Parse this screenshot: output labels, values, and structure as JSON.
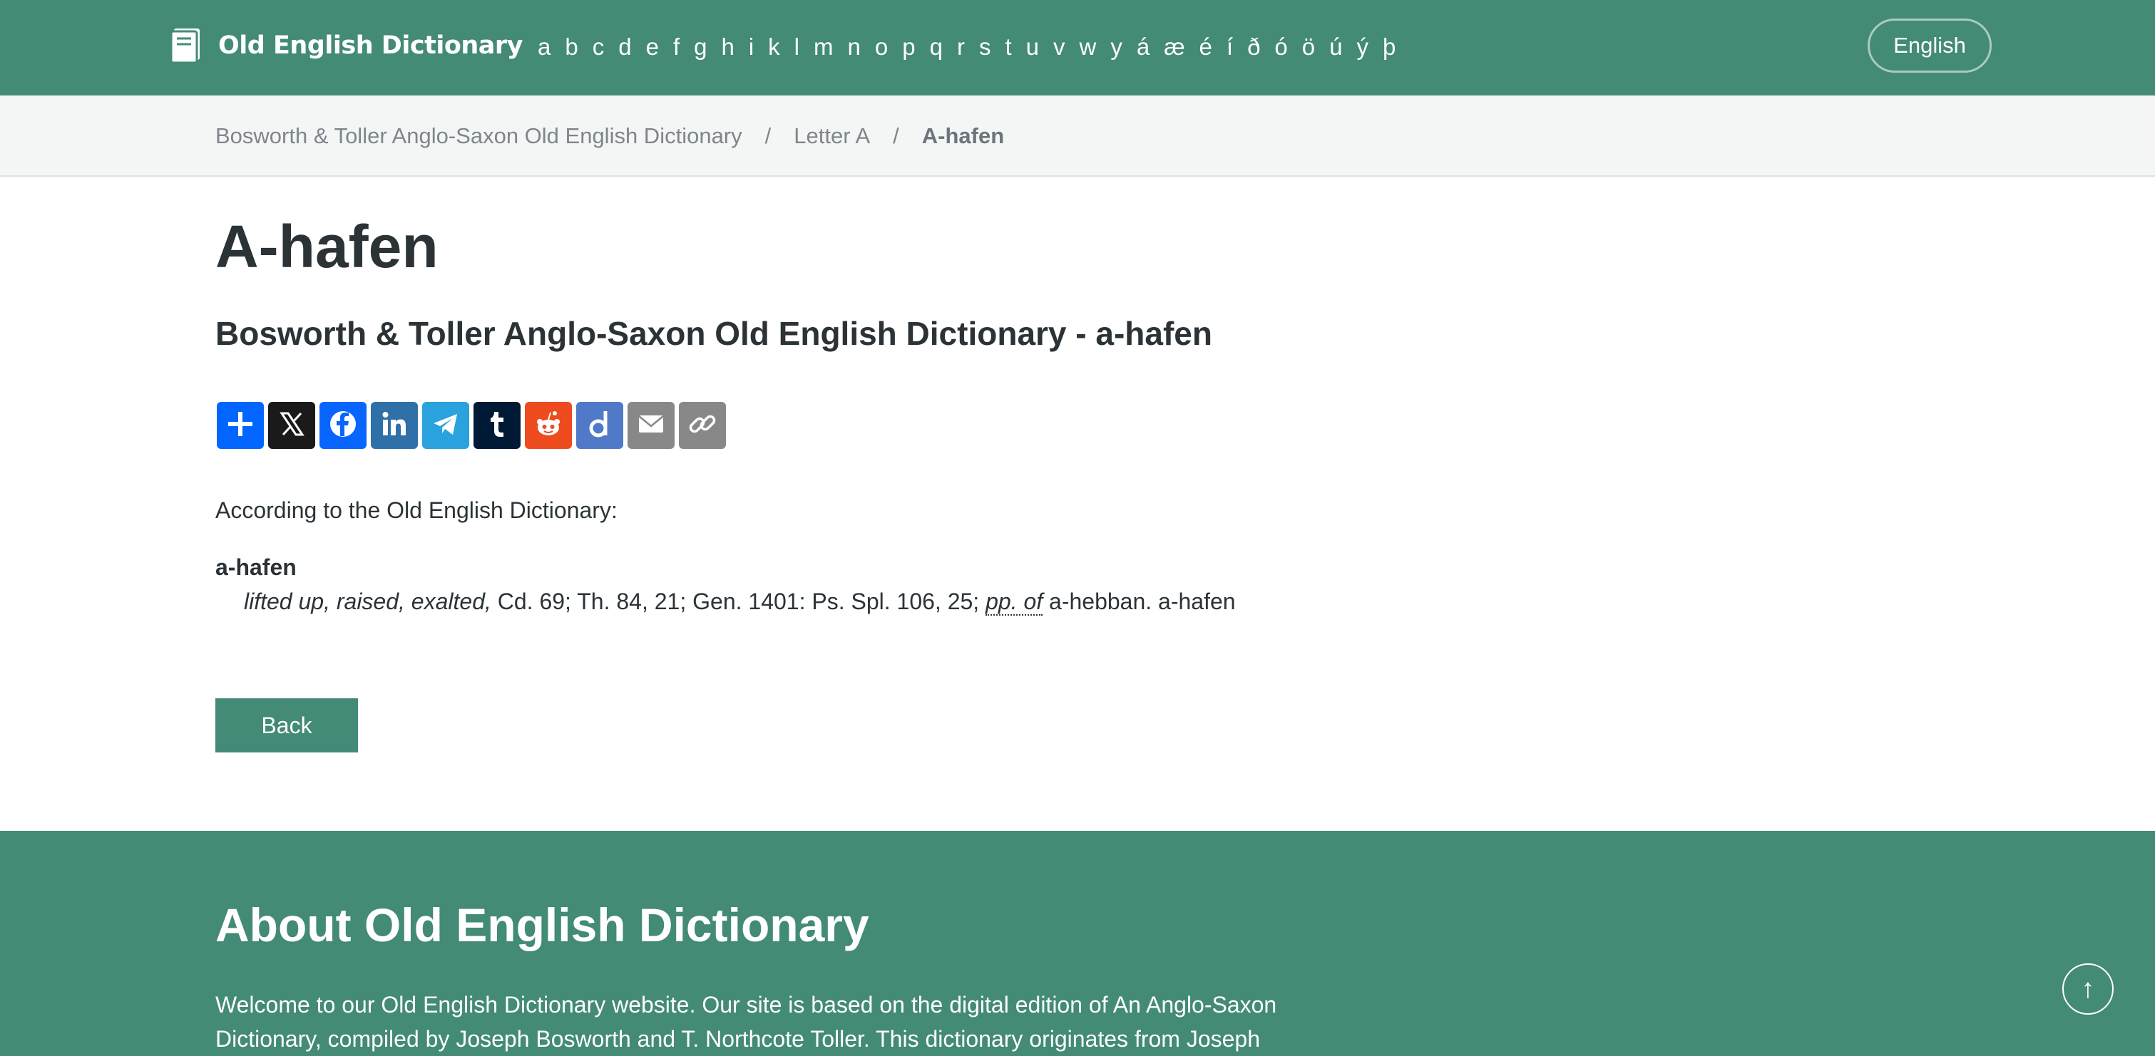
{
  "navbar": {
    "brand": "Old English Dictionary",
    "brand_icon": "book-icon",
    "letters": [
      "a",
      "b",
      "c",
      "d",
      "e",
      "f",
      "g",
      "h",
      "i",
      "k",
      "l",
      "m",
      "n",
      "o",
      "p",
      "q",
      "r",
      "s",
      "t",
      "u",
      "v",
      "w",
      "y",
      "á",
      "æ",
      "é",
      "í",
      "ð",
      "ó",
      "ö",
      "ú",
      "ý",
      "þ"
    ],
    "language": "English"
  },
  "breadcrumb": {
    "items": [
      "Bosworth & Toller Anglo-Saxon Old English Dictionary",
      "Letter A"
    ],
    "separator": "/",
    "current": "A-hafen"
  },
  "main": {
    "title": "A-hafen",
    "subtitle": "Bosworth & Toller Anglo-Saxon Old English Dictionary - a-hafen",
    "share_buttons": [
      {
        "name": "share-add",
        "icon": "plus-icon",
        "color": "#0166ff"
      },
      {
        "name": "share-x",
        "icon": "x-icon",
        "color": "#1a1a1a"
      },
      {
        "name": "share-facebook",
        "icon": "facebook-icon",
        "color": "#0866ff"
      },
      {
        "name": "share-linkedin",
        "icon": "linkedin-icon",
        "color": "#2f70a8"
      },
      {
        "name": "share-telegram",
        "icon": "telegram-icon",
        "color": "#2aa2dd"
      },
      {
        "name": "share-tumblr",
        "icon": "tumblr-icon",
        "color": "#001935"
      },
      {
        "name": "share-reddit",
        "icon": "reddit-icon",
        "color": "#ee4b1f"
      },
      {
        "name": "share-diaspora",
        "icon": "diaspora-icon",
        "color": "#5079c8"
      },
      {
        "name": "share-email",
        "icon": "email-icon",
        "color": "#888888"
      },
      {
        "name": "share-copy-link",
        "icon": "link-icon",
        "color": "#888888"
      }
    ],
    "intro": "According to the Old English Dictionary:",
    "entry": {
      "headword": "a-hafen",
      "definition_italic": "lifted up, raised, exalted,",
      "references": "Cd. 69; Th. 84, 21; Gen. 1401: Ps. Spl. 106, 25;",
      "abbr": "pp. of",
      "tail": "a-hebban. a-hafen"
    },
    "back_label": "Back"
  },
  "footer": {
    "title": "About Old English Dictionary",
    "text": "Welcome to our Old English Dictionary website. Our site is based on the digital edition of An Anglo-Saxon Dictionary, compiled by Joseph Bosworth and T. Northcote Toller. This dictionary originates from Joseph",
    "scroll_top_glyph": "↑"
  },
  "colors": {
    "brand_green": "#438a77",
    "breadcrumb_bg": "#f4f5f5",
    "text_dark": "#2b3337"
  }
}
